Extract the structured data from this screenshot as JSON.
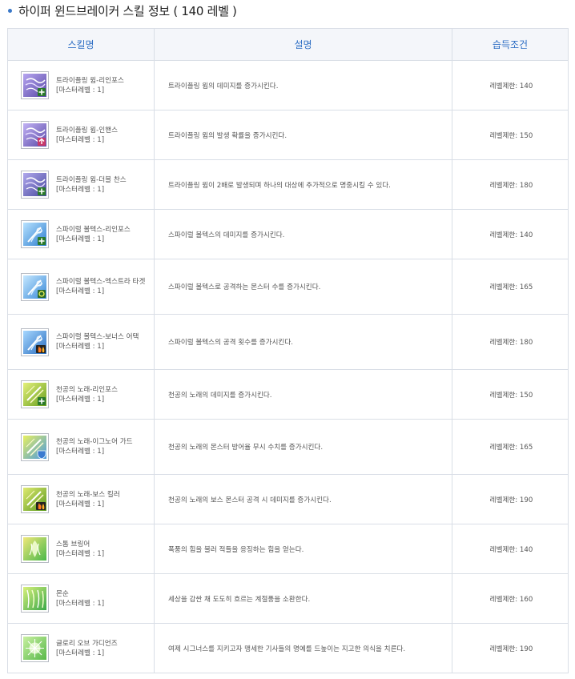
{
  "page": {
    "title": "하이퍼 윈드브레이커 스킬 정보 ( 140 레벨 )"
  },
  "table": {
    "headers": {
      "skill": "스킬명",
      "desc": "설명",
      "cond": "습득조건"
    },
    "rows": [
      {
        "name": "트라이플링 윔-리인포스",
        "level": "[마스터레벨 : 1]",
        "desc": "트라이플링 윔의 데미지를 증가시킨다.",
        "cond": "레벨제한: 140",
        "icon": "triflingwhim-reinforce-icon"
      },
      {
        "name": "트라이플링 윔-인핸스",
        "level": "[마스터레벨 : 1]",
        "desc": "트라이플링 윔의 발생 확률을 증가시킨다.",
        "cond": "레벨제한: 150",
        "icon": "triflingwhim-enhance-icon"
      },
      {
        "name": "트라이플링 윔-더블 찬스",
        "level": "[마스터레벨 : 1]",
        "desc": "트라이플링 윔이 2배로 발생되며 하나의 대상에 추가적으로 명중시킬 수 있다.",
        "cond": "레벨제한: 180",
        "icon": "triflingwhim-doublechance-icon"
      },
      {
        "name": "스파이럴 볼텍스-리인포스",
        "level": "[마스터레벨 : 1]",
        "desc": "스파이럴 볼텍스의 데미지를 증가시킨다.",
        "cond": "레벨제한: 140",
        "icon": "spiralvortex-reinforce-icon"
      },
      {
        "name": "스파이럴 볼텍스-엑스트라 타겟",
        "level": "[마스터레벨 : 1]",
        "desc": "스파이럴 볼텍스로 공격하는 몬스터 수를 증가시킨다.",
        "cond": "레벨제한: 165",
        "icon": "spiralvortex-extratarget-icon"
      },
      {
        "name": "스파이럴 볼텍스-보너스 어택",
        "level": "[마스터레벨 : 1]",
        "desc": "스파이럴 볼텍스의 공격 횟수를 증가시킨다.",
        "cond": "레벨제한: 180",
        "icon": "spiralvortex-bonusattack-icon"
      },
      {
        "name": "천공의 노래-리인포스",
        "level": "[마스터레벨 : 1]",
        "desc": "천공의 노래의 데미지를 증가시킨다.",
        "cond": "레벨제한: 150",
        "icon": "songofheaven-reinforce-icon"
      },
      {
        "name": "천공의 노래-이그노어 가드",
        "level": "[마스터레벨 : 1]",
        "desc": "천공의 노래의 몬스터 방어율 무시 수치를 증가시킨다.",
        "cond": "레벨제한: 165",
        "icon": "songofheaven-ignoreguard-icon"
      },
      {
        "name": "천공의 노래-보스 킬러",
        "level": "[마스터레벨 : 1]",
        "desc": "천공의 노래의 보스 몬스터 공격 시 데미지를 증가시킨다.",
        "cond": "레벨제한: 190",
        "icon": "songofheaven-bosskiller-icon"
      },
      {
        "name": "스톰 브링어",
        "level": "[마스터레벨 : 1]",
        "desc": "폭풍의 힘을 불러 적들을 응징하는 힘을 얻는다.",
        "cond": "레벨제한: 140",
        "icon": "stormbringer-icon"
      },
      {
        "name": "몬순",
        "level": "[마스터레벨 : 1]",
        "desc": "세상을 감싼 채 도도히 흐르는 계절풍을 소환한다.",
        "cond": "레벨제한: 160",
        "icon": "monsoon-icon"
      },
      {
        "name": "글로리 오브 가디언즈",
        "level": "[마스터레벨 : 1]",
        "desc": "여제 시그너스를 지키고자 맹세한 기사들의 명예를 드높이는 지고한 의식을 치른다.",
        "cond": "레벨제한: 190",
        "icon": "gloryofguardians-icon"
      }
    ]
  }
}
